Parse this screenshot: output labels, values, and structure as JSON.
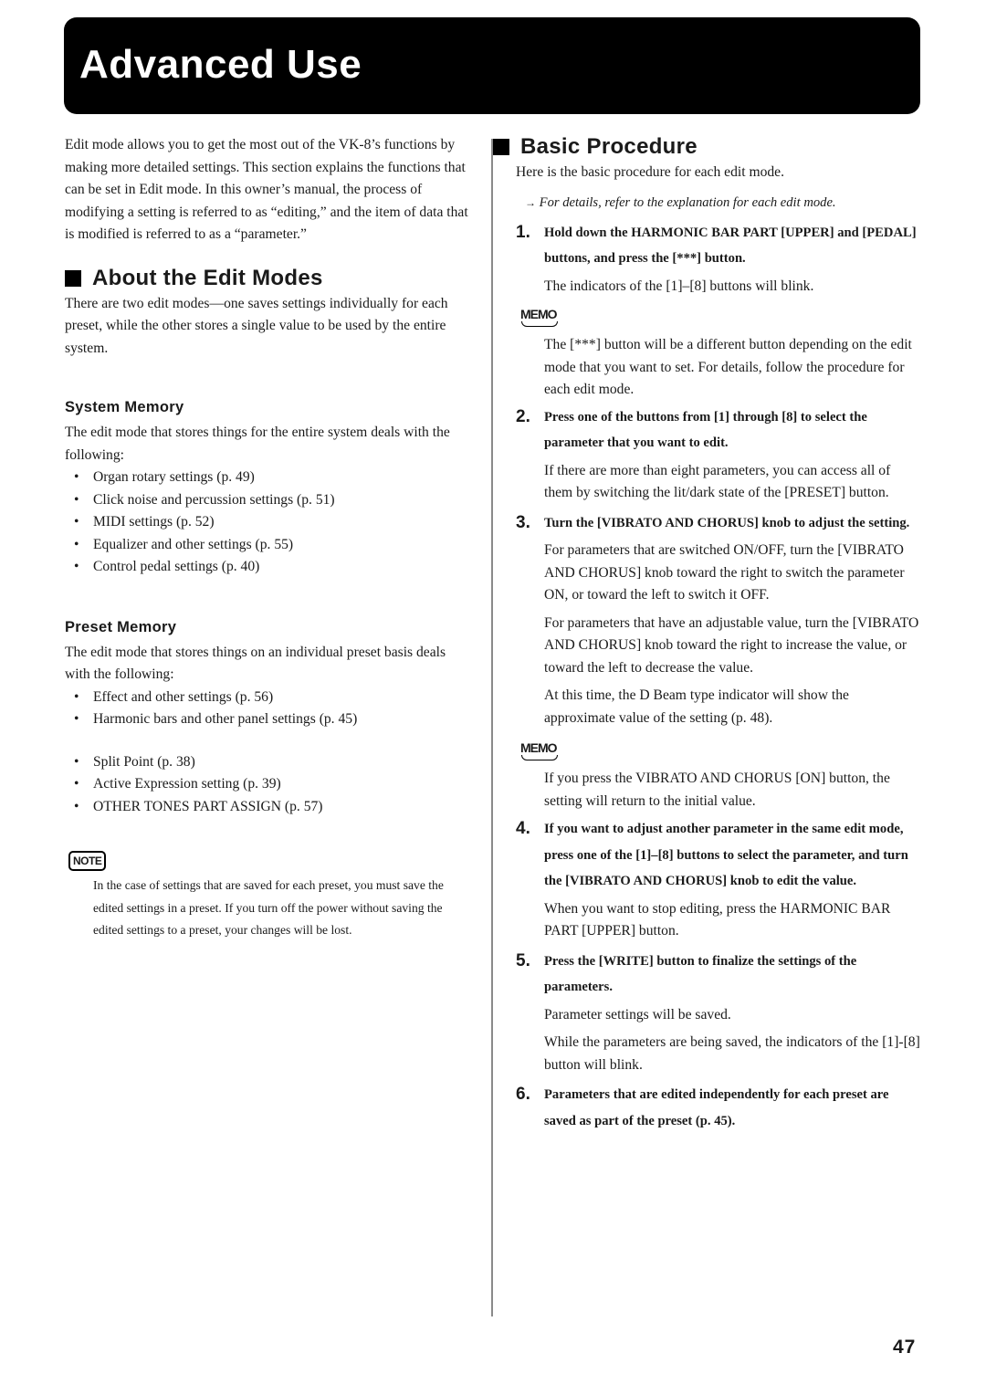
{
  "header": {
    "title": "Advanced Use"
  },
  "left": {
    "intro": "Edit mode allows you to get the most out of the VK-8’s functions by making more detailed settings. This section explains the functions that can be set in Edit mode. In this owner’s manual, the process of modifying a setting is referred to as “editing,” and the item of data that is modified is referred to as a “parameter.”",
    "about": {
      "heading": "About the Edit Modes",
      "text": "There are two edit modes—one saves settings individually for each preset, while the other stores a single value to be used by the entire system."
    },
    "system_memory": {
      "heading": "System Memory",
      "text": "The edit mode that stores things for the entire system deals with the following:",
      "items": [
        "Organ rotary settings (p. 49)",
        "Click noise and percussion settings (p. 51)",
        "MIDI settings (p. 52)",
        "Equalizer and other settings (p. 55)",
        "Control pedal settings (p. 40)"
      ]
    },
    "preset_memory": {
      "heading": "Preset Memory",
      "text": "The edit mode that stores things on an individual preset basis deals with the following:",
      "items_a": [
        "Effect and other settings (p. 56)",
        "Harmonic bars and other panel settings (p. 45)"
      ],
      "items_b": [
        "Split Point (p. 38)",
        "Active Expression setting (p. 39)",
        "OTHER TONES PART ASSIGN (p. 57)"
      ]
    },
    "note": {
      "badge": "NOTE",
      "text": "In the case of settings that are saved for each preset, you must save the edited settings in a preset. If you turn off the power without saving the edited settings to a preset, your changes will be lost."
    }
  },
  "right": {
    "heading": "Basic Procedure",
    "intro": "Here is the basic procedure for each edit mode.",
    "xref_arrow": "→",
    "xref": "For details, refer to the explanation for each edit mode.",
    "memo_label": "MEMO",
    "steps": [
      {
        "num": "1.",
        "text": "Hold down the HARMONIC BAR PART [UPPER] and [PEDAL] buttons, and press the [***] button.",
        "body": [
          "The indicators of the [1]–[8] buttons will blink."
        ],
        "memo": "The [***] button will be a different button depending on the edit mode that you want to set. For details, follow the procedure for each edit mode."
      },
      {
        "num": "2.",
        "text": "Press one of the buttons from [1] through [8] to select the parameter that you want to edit.",
        "body": [
          "If there are more than eight parameters, you can access all of them by switching the lit/dark state of the [PRESET] button."
        ]
      },
      {
        "num": "3.",
        "text": "Turn the [VIBRATO AND CHORUS] knob to adjust the setting.",
        "body": [
          "For parameters that are switched ON/OFF, turn the [VIBRATO AND CHORUS] knob toward the right to switch the parameter ON, or toward the left to switch it OFF.",
          "For parameters that have an adjustable value, turn the [VIBRATO AND CHORUS] knob toward the right to increase the value, or toward the left to decrease the value.",
          "At this time, the D Beam type indicator will show the approximate value of the setting (p. 48)."
        ],
        "memo": "If you press the VIBRATO AND CHORUS [ON] button, the setting will return to the initial value."
      },
      {
        "num": "4.",
        "text": "If you want to adjust another parameter in the same edit mode, press one of the [1]–[8] buttons to select the parameter, and turn the [VIBRATO AND CHORUS] knob to edit the value.",
        "body": [
          "When you want to stop editing, press the HARMONIC BAR PART [UPPER] button."
        ]
      },
      {
        "num": "5.",
        "text": "Press the [WRITE] button to finalize the settings of the parameters.",
        "body": [
          "Parameter settings will be saved.",
          "While the parameters are being saved, the indicators of the [1]-[8] button will blink."
        ]
      },
      {
        "num": "6.",
        "text": "Parameters that are edited independently for each preset are saved as part of the preset (p. 45).",
        "body": []
      }
    ]
  },
  "footer": {
    "page_number": "47"
  }
}
